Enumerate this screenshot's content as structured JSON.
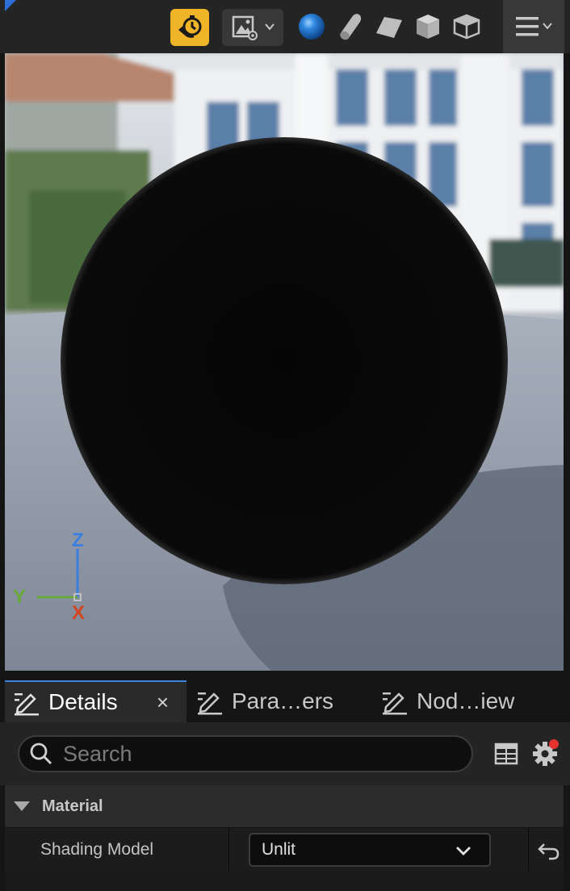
{
  "toolbar": {
    "realtime_icon": "realtime-stopwatch-icon",
    "preview_icon": "preview-scene-settings-icon",
    "shapes": [
      "sphere-icon",
      "cylinder-icon",
      "plane-icon",
      "cube-icon",
      "custom-mesh-icon"
    ],
    "menu_icon": "hamburger-menu-icon",
    "accent": "#f0b429"
  },
  "viewport": {
    "axis": {
      "z": "Z",
      "y": "Y",
      "x": "X"
    },
    "axis_colors": {
      "z": "#3a7fe0",
      "y": "#6aa83a",
      "x": "#d2461f"
    }
  },
  "tabs": [
    {
      "label": "Details",
      "active": true
    },
    {
      "label": "Para…ers",
      "active": false
    },
    {
      "label": "Nod…iew",
      "active": false
    }
  ],
  "tab_close": "×",
  "search": {
    "placeholder": "Search",
    "value": ""
  },
  "category": {
    "label": "Material"
  },
  "property": {
    "name": "Shading Model",
    "value": "Unlit"
  }
}
